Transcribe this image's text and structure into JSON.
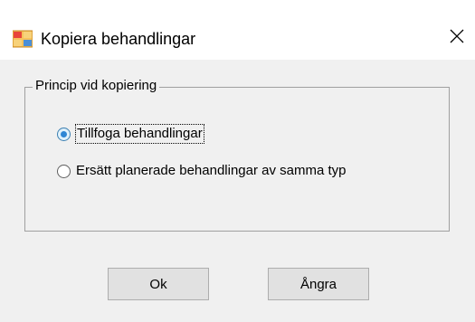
{
  "window": {
    "title": "Kopiera behandlingar",
    "icon": "application-icon",
    "close_icon": "close-icon"
  },
  "group": {
    "legend": "Princip vid kopiering",
    "options": [
      {
        "label": "Tillfoga behandlingar",
        "checked": true
      },
      {
        "label": "Ersätt planerade behandlingar av samma typ",
        "checked": false
      }
    ]
  },
  "buttons": {
    "ok_label": "Ok",
    "cancel_label": "Ångra"
  },
  "colors": {
    "dialog_background": "#f0f0f0",
    "titlebar_background": "#ffffff",
    "radio_checked": "#2e86d4",
    "button_background": "#e1e1e1"
  }
}
